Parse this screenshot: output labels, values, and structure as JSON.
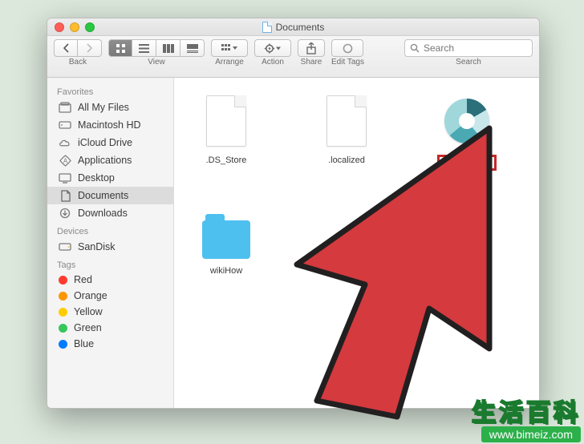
{
  "title": "Documents",
  "toolbar": {
    "back_label": "Back",
    "view_label": "View",
    "arrange_label": "Arrange",
    "action_label": "Action",
    "share_label": "Share",
    "tags_label": "Edit Tags",
    "search_label": "Search",
    "search_placeholder": "Search"
  },
  "sidebar": {
    "sections": [
      {
        "header": "Favorites",
        "items": [
          {
            "icon": "all-files",
            "label": "All My Files",
            "selected": false
          },
          {
            "icon": "hdd",
            "label": "Macintosh HD",
            "selected": false
          },
          {
            "icon": "cloud",
            "label": "iCloud Drive",
            "selected": false
          },
          {
            "icon": "apps",
            "label": "Applications",
            "selected": false
          },
          {
            "icon": "desktop",
            "label": "Desktop",
            "selected": false
          },
          {
            "icon": "doc",
            "label": "Documents",
            "selected": true
          },
          {
            "icon": "downloads",
            "label": "Downloads",
            "selected": false
          }
        ]
      },
      {
        "header": "Devices",
        "items": [
          {
            "icon": "disk",
            "label": "SanDisk",
            "selected": false
          }
        ]
      },
      {
        "header": "Tags",
        "items": [
          {
            "icon": "tag",
            "color": "#ff3b30",
            "label": "Red"
          },
          {
            "icon": "tag",
            "color": "#ff9500",
            "label": "Orange"
          },
          {
            "icon": "tag",
            "color": "#ffcc00",
            "label": "Yellow"
          },
          {
            "icon": "tag",
            "color": "#34c759",
            "label": "Green"
          },
          {
            "icon": "tag",
            "color": "#007aff",
            "label": "Blue"
          }
        ]
      }
    ]
  },
  "files": [
    {
      "name": ".DS_Store",
      "kind": "blankdoc",
      "highlighted": false
    },
    {
      "name": ".localized",
      "kind": "blankdoc",
      "highlighted": false
    },
    {
      "name": "cd_mac.icns",
      "kind": "icns",
      "highlighted": true
    },
    {
      "name": "wikiHow",
      "kind": "folder",
      "highlighted": false
    }
  ],
  "watermark": {
    "top": "生活百科",
    "bottom": "www.bimeiz.com"
  }
}
